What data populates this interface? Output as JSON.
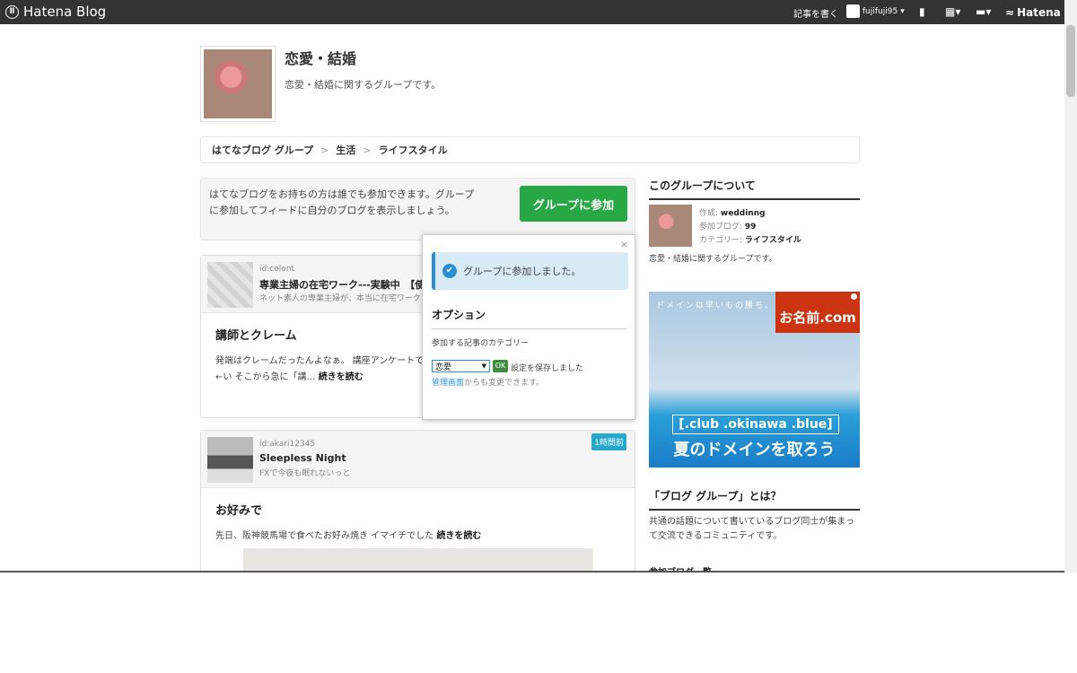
{
  "topbar": {
    "logo_text": "Hatena Blog",
    "logo_mark": "Ⅱ",
    "write_label": "記事を書く",
    "username": "fujifuji95",
    "brand_label": "Hatena"
  },
  "group": {
    "title": "恋愛・結婚",
    "description": "恋愛・結婚に関するグループです。"
  },
  "breadcrumb": {
    "items": [
      "はてなブログ グループ",
      "生活",
      "ライフスタイル"
    ],
    "separator": ">"
  },
  "join": {
    "text": "はてなブログをお持ちの方は誰でも参加できます。グループに参加してフィードに自分のブログを表示しましょう。",
    "button_label": "グループに参加"
  },
  "entries": [
    {
      "id": "id:colont",
      "blog_title": "専業主婦の在宅ワーク---実験中　【使",
      "blog_sub": "ネット素人の専業主婦が、本当に在宅ワーク",
      "title": "講師とクレーム",
      "excerpt": "発端はクレームだったんよなぁ。 講座アンケートで らしい。 事務員さんがコッソリ教えてくれた… ←い そこから急に「講…",
      "read_more": "続きを読む"
    },
    {
      "id": "id:akari12345",
      "blog_title": "Sleepless Night",
      "blog_sub": "FXで今夜も眠れないっと",
      "time": "1時間前",
      "title": "お好みで",
      "excerpt": "先日、阪神競馬場で食べたお好み焼き イマイチでした",
      "read_more": "続きを読む"
    }
  ],
  "popup": {
    "close_label": "×",
    "alert_text": "グループに参加しました。",
    "check_glyph": "✔",
    "heading": "オプション",
    "category_label": "参加する記事のカテゴリー",
    "selected_category": "恋愛",
    "select_arrow": "▼",
    "ok_label": "OK",
    "saved_text": "設定を保存しました",
    "note_link": "管理画面",
    "note_text": "からも変更できます。"
  },
  "sidebar": {
    "about_heading": "このグループについて",
    "created_label": "作成: ",
    "created_value": "weddinng",
    "blogs_label": "参加ブログ: ",
    "blogs_value": "99",
    "category_label": "カテゴリー: ",
    "category_value": "ライフスタイル",
    "about_desc": "恋愛・結婚に関するグループです。",
    "what_heading": "「ブログ グループ」とは？",
    "what_text": "共通の話題について書いているブログ同士が集まって交流できるコミュニティです。",
    "next_heading": "参加ブログ一覧"
  },
  "ad": {
    "top_text": "ドメインは早いもの勝ち。",
    "badge": "お名前.com",
    "line1": "[.club .okinawa .blue]",
    "line2": "夏のドメインを取ろう"
  }
}
